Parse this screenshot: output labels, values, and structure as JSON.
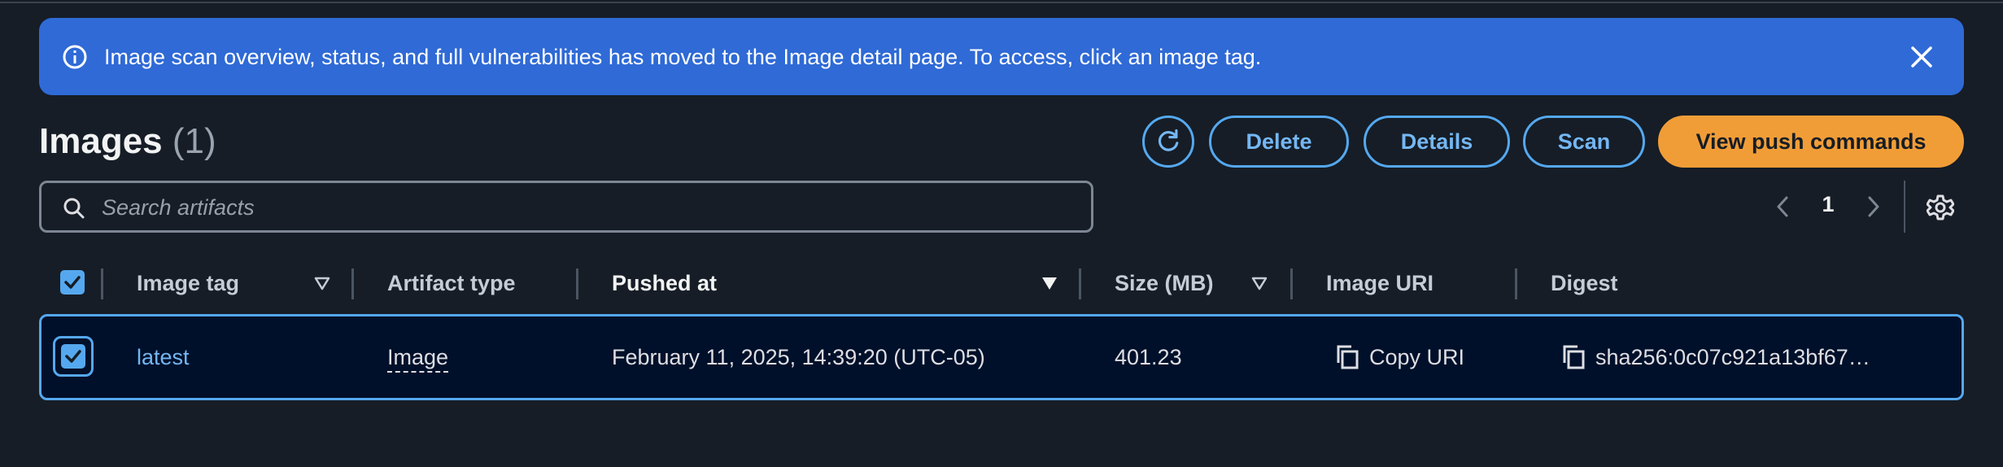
{
  "flash": {
    "message": "Image scan overview, status, and full vulnerabilities has moved to the Image detail page. To access, click an image tag.",
    "color": "#2f6ad6"
  },
  "header": {
    "title": "Images",
    "count": "(1)"
  },
  "actions": {
    "delete_label": "Delete",
    "details_label": "Details",
    "scan_label": "Scan",
    "push_label": "View push commands",
    "accent_color": "#55a8ef",
    "primary_color": "#f19d37"
  },
  "search": {
    "placeholder": "Search artifacts",
    "value": ""
  },
  "pagination": {
    "current_page": "1"
  },
  "table": {
    "columns": [
      "Image tag",
      "Artifact type",
      "Pushed at",
      "Size (MB)",
      "Image URI",
      "Digest"
    ],
    "rows": [
      {
        "image_tag": "latest",
        "artifact_type": "Image",
        "pushed_at": "February 11, 2025, 14:39:20 (UTC-05)",
        "size_mb": "401.23",
        "image_uri": "Copy URI",
        "digest": "sha256:0c07c921a13bf67…",
        "selected": true
      }
    ]
  },
  "icons": [
    "info-icon",
    "close-icon",
    "refresh-icon",
    "search-icon",
    "chevron-left-icon",
    "chevron-right-icon",
    "settings-icon",
    "sort-down-icon",
    "copy-icon",
    "checkbox-checked-icon"
  ]
}
